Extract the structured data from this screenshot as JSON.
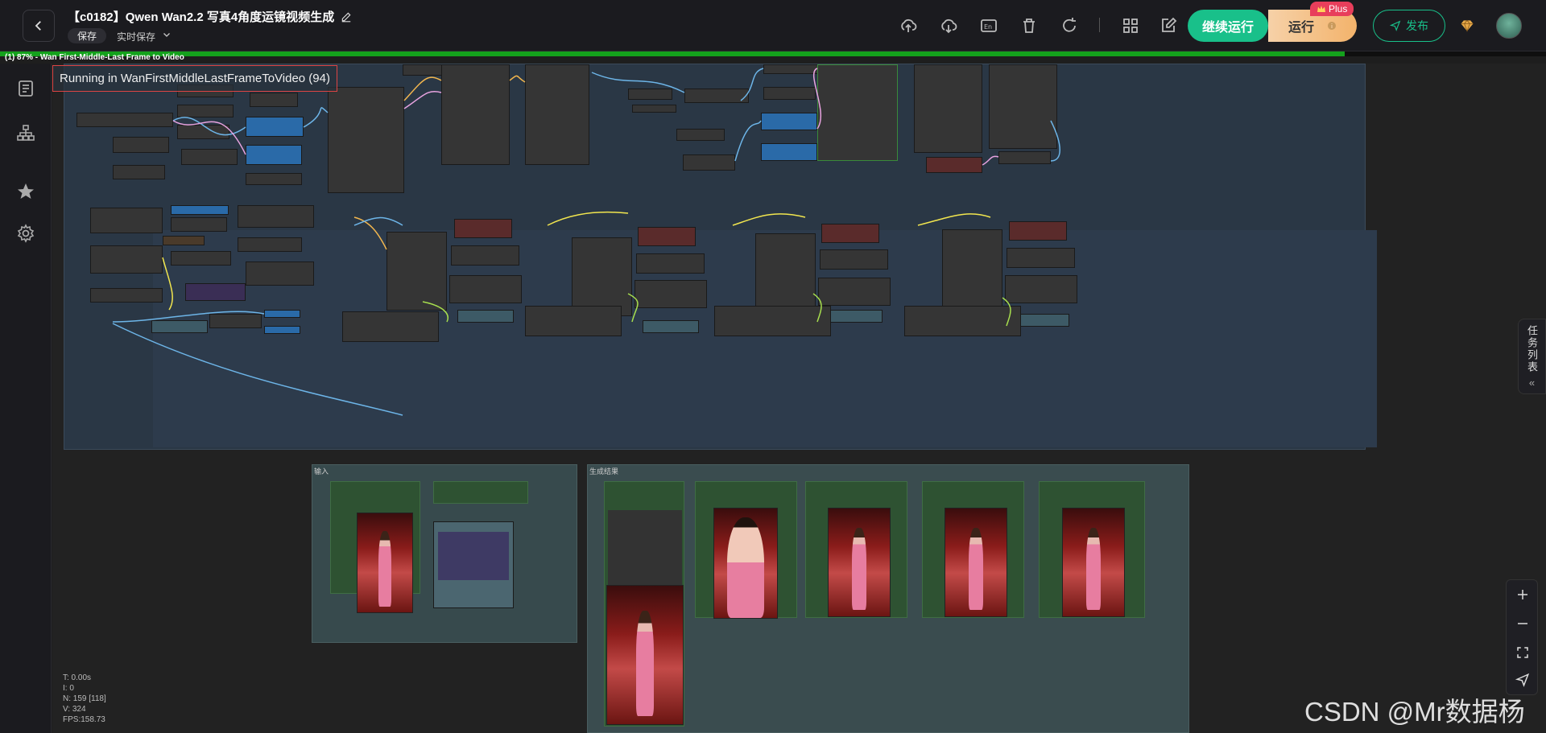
{
  "header": {
    "title": "【c0182】Qwen Wan2.2 写真4角度运镜视频生成",
    "save_label": "保存",
    "autosave_label": "实时保存",
    "continue_label": "继续运行",
    "run_label": "运行",
    "plus_badge": "Plus",
    "publish_label": "发布"
  },
  "progress": {
    "percent": 87,
    "status_text": "(1) 87% - Wan First-Middle-Last Frame to Video"
  },
  "canvas": {
    "running_label": "Running in WanFirstMiddleLastFrameToVideo (94)",
    "group_input_label": "输入",
    "group_output_label": "生成结果"
  },
  "stats": {
    "t": "T: 0.00s",
    "i": "I: 0",
    "n": "N: 159 [118]",
    "v": "V: 324",
    "fps": "FPS:158.73"
  },
  "task_panel": {
    "label": "任务列表"
  },
  "watermark": "CSDN @Mr数据杨",
  "colors": {
    "accent_green": "#19c08a",
    "progress_green": "#14a11c",
    "run_gold": "#f3b36b",
    "plus_red": "#e83e5b"
  }
}
